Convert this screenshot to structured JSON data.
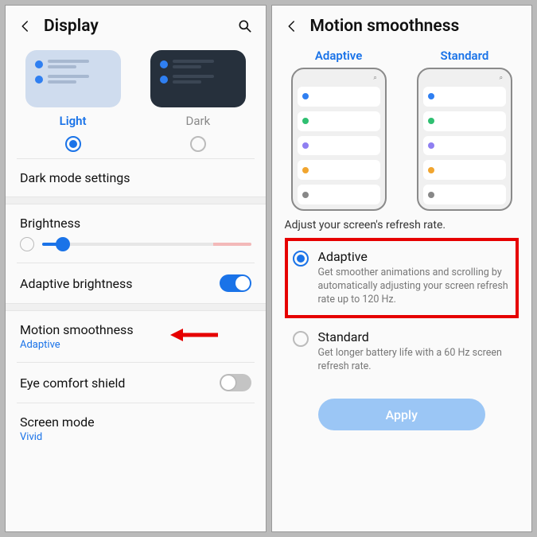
{
  "left": {
    "title": "Display",
    "themes": {
      "light": "Light",
      "dark": "Dark",
      "selected": "light"
    },
    "darkModeSettings": "Dark mode settings",
    "brightness": {
      "label": "Brightness"
    },
    "adaptiveBrightness": {
      "label": "Adaptive brightness",
      "on": true
    },
    "motionSmoothness": {
      "label": "Motion smoothness",
      "value": "Adaptive"
    },
    "eyeComfort": {
      "label": "Eye comfort shield",
      "on": false
    },
    "screenMode": {
      "label": "Screen mode",
      "value": "Vivid"
    }
  },
  "right": {
    "title": "Motion smoothness",
    "tabs": {
      "adaptive": "Adaptive",
      "standard": "Standard"
    },
    "desc": "Adjust your screen's refresh rate.",
    "optAdaptive": {
      "title": "Adaptive",
      "desc": "Get smoother animations and scrolling by automatically adjusting your screen refresh rate up to 120 Hz."
    },
    "optStandard": {
      "title": "Standard",
      "desc": "Get longer battery life with a 60 Hz screen refresh rate."
    },
    "apply": "Apply"
  }
}
